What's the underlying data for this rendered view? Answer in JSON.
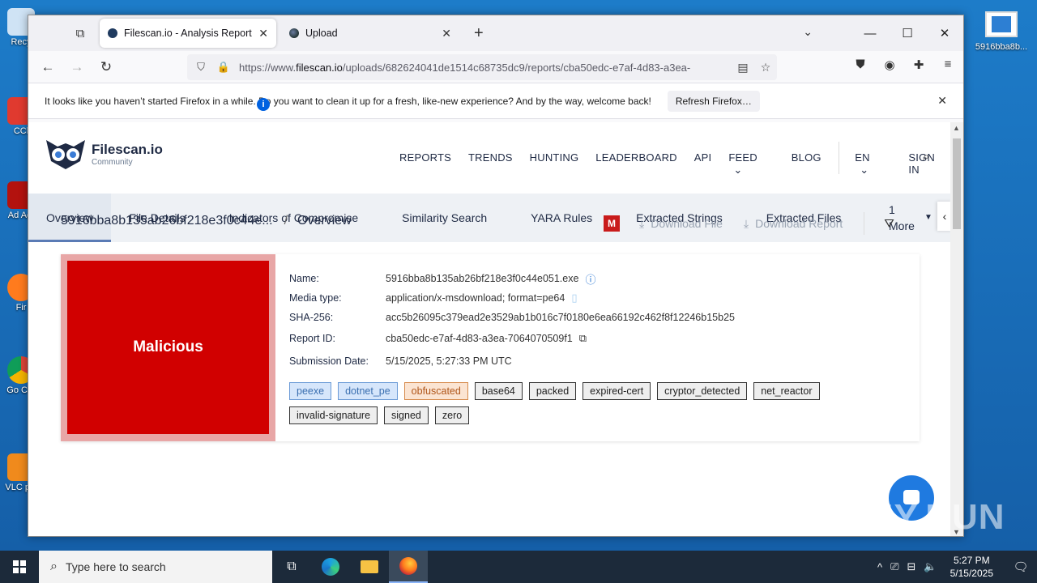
{
  "desktop": {
    "left_icons": [
      {
        "name": "recycle-bin",
        "label": "Recy"
      },
      {
        "name": "ccleaner",
        "label": "CCl"
      },
      {
        "name": "acrobat",
        "label": "Ad Acr"
      },
      {
        "name": "firefox",
        "label": "Fir"
      },
      {
        "name": "chrome",
        "label": "Go Chr"
      },
      {
        "name": "vlc",
        "label": "VLC pla"
      }
    ],
    "right_icon_label": "5916bba8b..."
  },
  "browser": {
    "tabs": [
      {
        "title": "Filescan.io - Analysis Report for",
        "active": true
      },
      {
        "title": "Upload",
        "active": false
      }
    ],
    "url_prefix": "https://www.",
    "url_domain": "filescan.io",
    "url_path": "/uploads/682624041de1514c68735dc9/reports/cba50edc-e7af-4d83-a3ea-",
    "notice_text": "It looks like you haven’t started Firefox in a while. Do you want to clean it up for a fresh, like-new experience? And by the way, welcome back!",
    "notice_button": "Refresh Firefox…"
  },
  "site": {
    "brand": "Filescan.io",
    "brand_sub": "Community",
    "menu": [
      "REPORTS",
      "TRENDS",
      "HUNTING",
      "LEADERBOARD",
      "API",
      "FEED"
    ],
    "menu_blog": "BLOG",
    "menu_lang": "EN",
    "menu_signin": "SIGN IN",
    "subnav": [
      "Overview",
      "File Details",
      "Indicators of Compromise",
      "Similarity Search",
      "YARA Rules",
      "Extracted Strings",
      "Extracted Files"
    ],
    "subnav_more_count": "1",
    "subnav_more_label": "More",
    "breadcrumb_file": "5916bba8b135ab26bf218e3f0c44e...",
    "breadcrumb_sep": "/",
    "breadcrumb_page": "Overview",
    "badge_letter": "M",
    "download_file": "Download File",
    "download_report": "Download Report"
  },
  "report": {
    "verdict": "Malicious",
    "verdict_color": "#d10000",
    "fields": [
      {
        "key": "Name:",
        "value": "5916bba8b135ab26bf218e3f0c44e051.exe"
      },
      {
        "key": "Media type:",
        "value": "application/x-msdownload; format=pe64"
      },
      {
        "key": "SHA-256:",
        "value": "acc5b26095c379ead2e3529ab1b016c7f0180e6ea66192c462f8f12246b15b25"
      },
      {
        "key": "Report ID:",
        "value": "cba50edc-e7af-4d83-a3ea-7064070509f1"
      },
      {
        "key": "Submission Date:",
        "value": "5/15/2025, 5:27:33 PM UTC"
      }
    ],
    "tags": [
      {
        "label": "peexe",
        "style": "blue"
      },
      {
        "label": "dotnet_pe",
        "style": "blue"
      },
      {
        "label": "obfuscated",
        "style": "orange"
      },
      {
        "label": "base64",
        "style": "gray"
      },
      {
        "label": "packed",
        "style": "gray"
      },
      {
        "label": "expired-cert",
        "style": "gray"
      },
      {
        "label": "cryptor_detected",
        "style": "gray"
      },
      {
        "label": "net_reactor",
        "style": "gray"
      },
      {
        "label": "invalid-signature",
        "style": "gray"
      },
      {
        "label": "signed",
        "style": "gray"
      },
      {
        "label": "zero",
        "style": "gray"
      }
    ]
  },
  "watermark": "ANY.RUN",
  "taskbar": {
    "search_placeholder": "Type here to search",
    "time": "5:27 PM",
    "date": "5/15/2025"
  }
}
